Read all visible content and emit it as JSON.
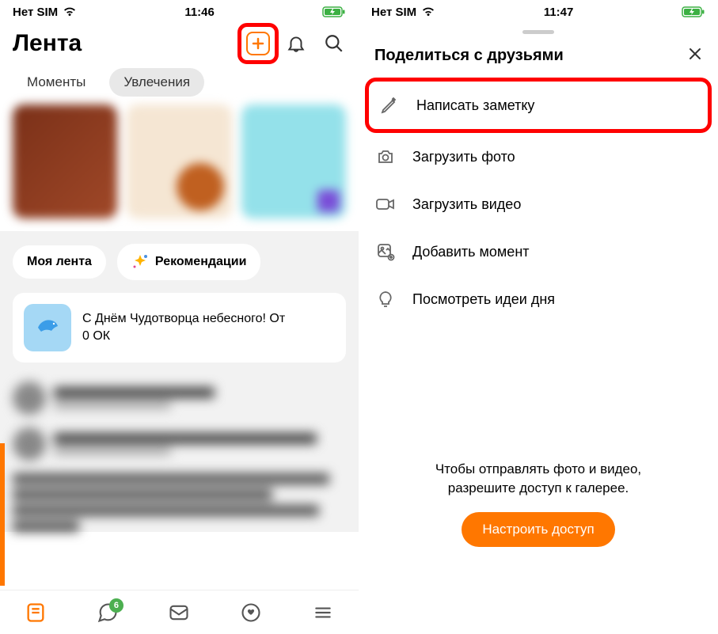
{
  "left": {
    "status": {
      "carrier": "Нет SIM",
      "time": "11:46"
    },
    "title": "Лента",
    "tabs": {
      "moments": "Моменты",
      "hobbies": "Увлечения"
    },
    "chips": {
      "my_feed": "Моя лента",
      "recommendations": "Рекомендации"
    },
    "promo": {
      "line1": "С Днём Чудотворца небесного! От",
      "line2": "0 ОК"
    },
    "nav_badge": "6"
  },
  "right": {
    "status": {
      "carrier": "Нет SIM",
      "time": "11:47"
    },
    "sheet_title": "Поделиться с друзьями",
    "options": {
      "write_note": "Написать заметку",
      "upload_photo": "Загрузить фото",
      "upload_video": "Загрузить видео",
      "add_moment": "Добавить момент",
      "view_ideas": "Посмотреть идеи дня"
    },
    "permission": {
      "line1": "Чтобы отправлять фото и видео,",
      "line2": "разрешите доступ к галерее.",
      "button": "Настроить доступ"
    }
  }
}
